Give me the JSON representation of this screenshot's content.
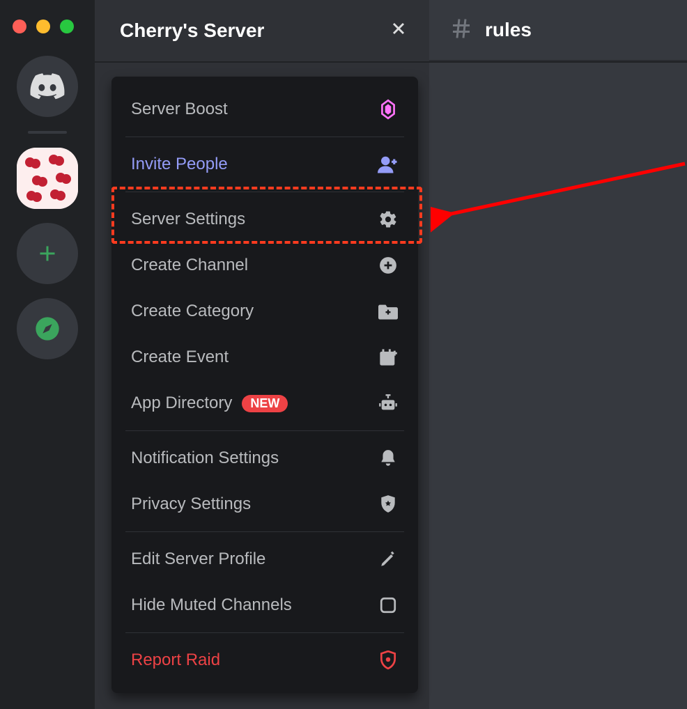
{
  "header": {
    "server_name": "Cherry's Server",
    "channel_name": "rules"
  },
  "menu": {
    "server_boost": "Server Boost",
    "invite_people": "Invite People",
    "server_settings": "Server Settings",
    "create_channel": "Create Channel",
    "create_category": "Create Category",
    "create_event": "Create Event",
    "app_directory": "App Directory",
    "app_directory_badge": "NEW",
    "notification_settings": "Notification Settings",
    "privacy_settings": "Privacy Settings",
    "edit_server_profile": "Edit Server Profile",
    "hide_muted_channels": "Hide Muted Channels",
    "report_raid": "Report Raid"
  }
}
